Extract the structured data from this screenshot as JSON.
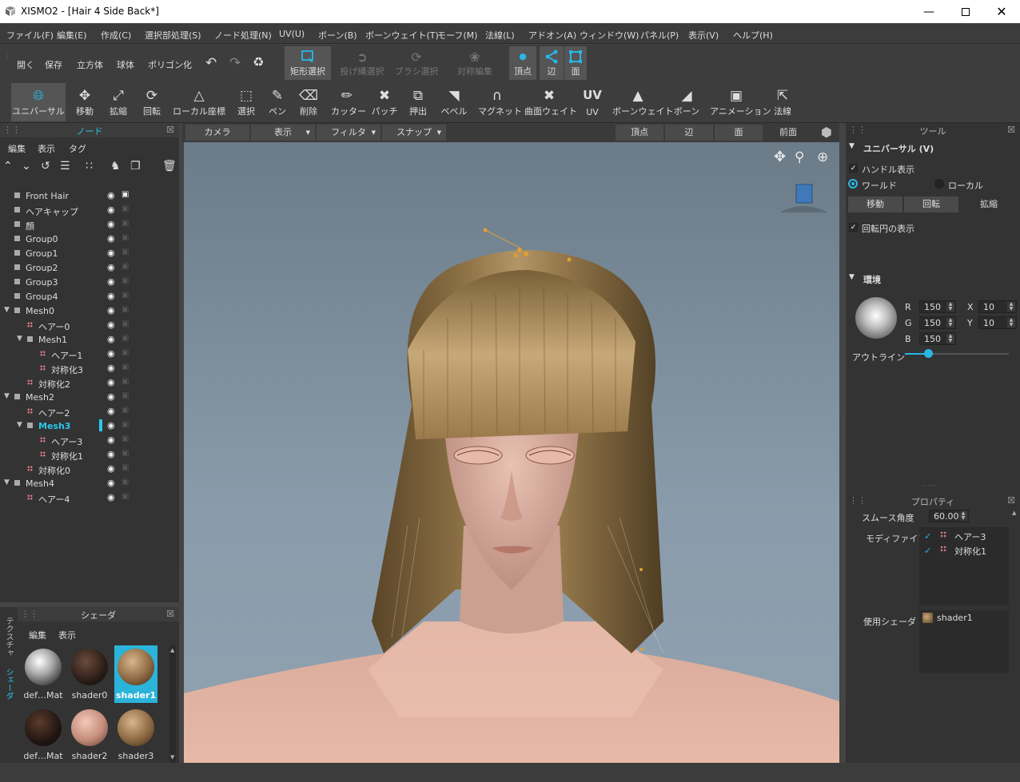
{
  "window": {
    "title": "XISMO2 - [Hair 4 Side Back*]"
  },
  "menu": [
    "ファイル(F)",
    "編集(E)",
    "作成(C)",
    "選択部処理(S)",
    "ノード処理(N)",
    "UV(U)",
    "ボーン(B)",
    "ボーンウェイト(T)",
    "モーフ(M)",
    "法線(L)",
    "アドオン(A)",
    "ウィンドウ(W)",
    "パネル(P)",
    "表示(V)",
    "ヘルプ(H)"
  ],
  "toolbar1": {
    "file": [
      "開く",
      "保存",
      "立方体",
      "球体",
      "ポリゴン化"
    ],
    "select": [
      {
        "label": "矩形選択",
        "icon": "rect-select-icon",
        "state": "selected"
      },
      {
        "label": "投げ縄選択",
        "icon": "lasso-icon",
        "state": "disabled"
      },
      {
        "label": "ブラシ選択",
        "icon": "brush-select-icon",
        "state": "disabled"
      },
      {
        "label": "対称編集",
        "icon": "butterfly-icon",
        "state": "disabled"
      }
    ],
    "mode": [
      {
        "label": "頂点",
        "icon": "vertex-icon"
      },
      {
        "label": "辺",
        "icon": "edge-icon"
      },
      {
        "label": "面",
        "icon": "face-icon"
      }
    ]
  },
  "toolbar2": [
    {
      "label": "ユニバーサル",
      "icon": "globe-icon",
      "selected": true
    },
    {
      "label": "移動",
      "icon": "move-icon"
    },
    {
      "label": "拡縮",
      "icon": "scale-icon"
    },
    {
      "label": "回転",
      "icon": "rotate-icon"
    },
    {
      "label": "ローカル座標",
      "icon": "axes-icon"
    },
    {
      "label": "選択",
      "icon": "select-icon"
    },
    {
      "label": "ペン",
      "icon": "pen-icon"
    },
    {
      "label": "削除",
      "icon": "eraser-icon"
    },
    {
      "label": "カッター",
      "icon": "cutter-icon"
    },
    {
      "label": "パッチ",
      "icon": "patch-icon"
    },
    {
      "label": "押出",
      "icon": "extrude-icon"
    },
    {
      "label": "ベベル",
      "icon": "bevel-icon"
    },
    {
      "label": "マグネット",
      "icon": "magnet-icon"
    },
    {
      "label": "曲面ウェイト",
      "icon": "surface-weight-icon"
    },
    {
      "label": "UV",
      "icon": "uv-icon"
    },
    {
      "label": "ボーンウェイト",
      "icon": "bone-weight-icon"
    },
    {
      "label": "ボーン",
      "icon": "bone-icon"
    },
    {
      "label": "アニメーション",
      "icon": "film-icon"
    },
    {
      "label": "法線",
      "icon": "normal-icon"
    }
  ],
  "node_panel": {
    "title": "ノード",
    "menu": [
      "編集",
      "表示",
      "タグ"
    ],
    "tree": [
      {
        "label": "Front Hair",
        "level": 0,
        "icon": "sq",
        "locked": true
      },
      {
        "label": "ヘアキャップ",
        "level": 0,
        "icon": "sq"
      },
      {
        "label": "顔",
        "level": 0,
        "icon": "sq"
      },
      {
        "label": "Group0",
        "level": 0,
        "icon": "sq"
      },
      {
        "label": "Group1",
        "level": 0,
        "icon": "sq"
      },
      {
        "label": "Group2",
        "level": 0,
        "icon": "sq"
      },
      {
        "label": "Group3",
        "level": 0,
        "icon": "sq"
      },
      {
        "label": "Group4",
        "level": 0,
        "icon": "sq"
      },
      {
        "label": "Mesh0",
        "level": 0,
        "icon": "sq",
        "expanded": true
      },
      {
        "label": "ヘアー0",
        "level": 1,
        "icon": "grid"
      },
      {
        "label": "Mesh1",
        "level": 1,
        "icon": "sq",
        "expanded": true
      },
      {
        "label": "ヘアー1",
        "level": 2,
        "icon": "grid"
      },
      {
        "label": "対称化3",
        "level": 2,
        "icon": "grid"
      },
      {
        "label": "対称化2",
        "level": 1,
        "icon": "grid"
      },
      {
        "label": "Mesh2",
        "level": 0,
        "icon": "sq",
        "expanded": true
      },
      {
        "label": "ヘアー2",
        "level": 1,
        "icon": "grid"
      },
      {
        "label": "Mesh3",
        "level": 1,
        "icon": "sq",
        "expanded": true,
        "selected": true
      },
      {
        "label": "ヘアー3",
        "level": 2,
        "icon": "grid"
      },
      {
        "label": "対称化1",
        "level": 2,
        "icon": "grid"
      },
      {
        "label": "対称化0",
        "level": 1,
        "icon": "grid"
      },
      {
        "label": "Mesh4",
        "level": 0,
        "icon": "sq",
        "expanded": true
      },
      {
        "label": "ヘアー4",
        "level": 1,
        "icon": "grid"
      }
    ]
  },
  "shader_panel": {
    "title": "シェーダ",
    "menu": [
      "編集",
      "表示"
    ],
    "side_tabs": [
      "テクスチャ",
      "シェーダ"
    ],
    "shaders": [
      {
        "name": "def…Mat",
        "style": "white"
      },
      {
        "name": "shader0",
        "style": "darkhair"
      },
      {
        "name": "shader1",
        "style": "brownhair",
        "selected": true
      },
      {
        "name": "def…Mat",
        "style": "darkhair2"
      },
      {
        "name": "shader2",
        "style": "skin"
      },
      {
        "name": "shader3",
        "style": "brownhair"
      }
    ]
  },
  "viewport_header": {
    "left": [
      "カメラ",
      "表示",
      "フィルタ",
      "スナップ"
    ],
    "right": [
      "頂点",
      "辺",
      "面",
      "前面"
    ]
  },
  "tool_panel": {
    "title": "ツール",
    "section": "ユニバーサル (V)",
    "handle_display": "ハンドル表示",
    "world": "ワールド",
    "local": "ローカル",
    "segments": [
      "移動",
      "回転",
      "拡縮"
    ],
    "show_rotation_circle": "回転円の表示",
    "env": {
      "title": "環境",
      "r_label": "R",
      "g_label": "G",
      "b_label": "B",
      "r": "150",
      "g": "150",
      "b": "150",
      "x_label": "X",
      "y_label": "Y",
      "x": "10",
      "y": "10",
      "outline_label": "アウトライン"
    }
  },
  "props_panel": {
    "title": "プロパティ",
    "smooth_label": "スムース角度",
    "smooth_value": "60.00",
    "modifier_label": "モディファイア",
    "modifiers": [
      "ヘアー3",
      "対称化1"
    ],
    "shader_label": "使用シェーダ",
    "shader_value": "shader1"
  }
}
